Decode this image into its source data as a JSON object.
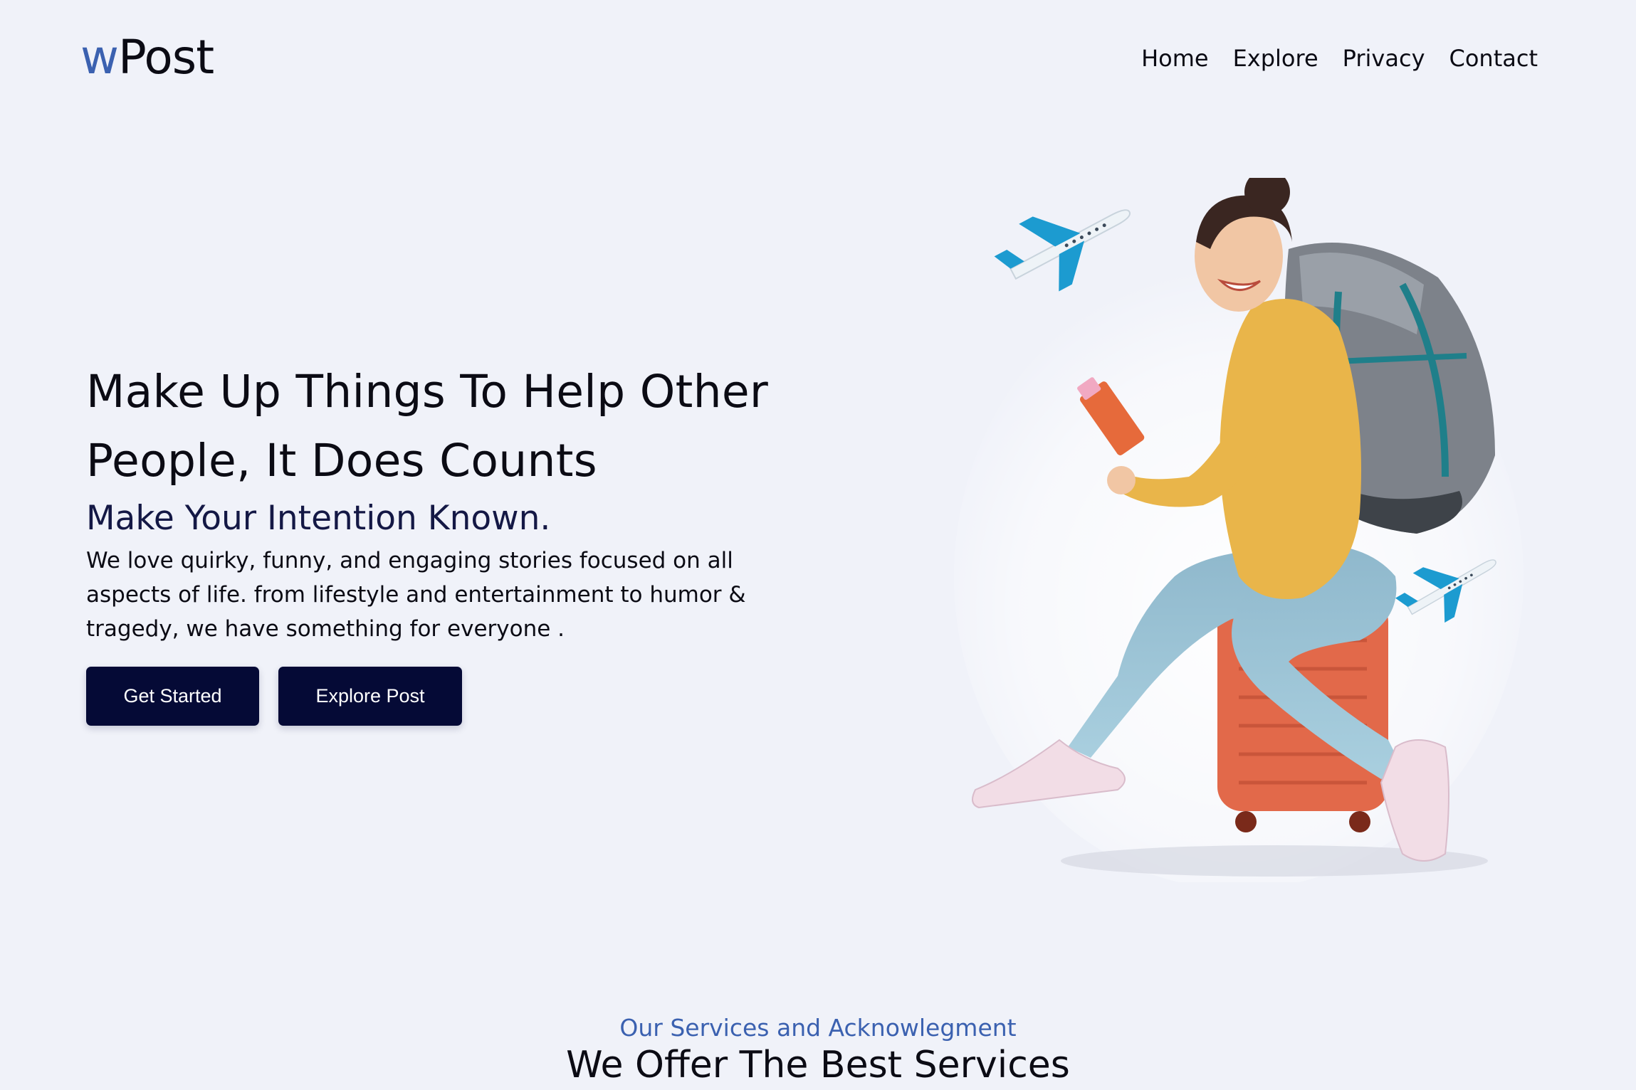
{
  "brand": {
    "logo_prefix": "w",
    "logo_rest": "Post",
    "accent_color": "#3b61b0",
    "dark_color": "#050a36",
    "background_color": "#f0f2f9"
  },
  "nav": {
    "items": [
      {
        "label": "Home"
      },
      {
        "label": "Explore"
      },
      {
        "label": "Privacy"
      },
      {
        "label": "Contact"
      }
    ]
  },
  "hero": {
    "title": "Make Up Things To Help Other People, It Does Counts",
    "subtitle": "Make Your Intention Known.",
    "description": "We love quirky, funny, and engaging stories focused on all aspects of life. from lifestyle and entertainment to humor & tragedy, we have something for everyone .",
    "buttons": {
      "primary": "Get Started",
      "secondary": "Explore Post"
    },
    "illustration": {
      "icons": [
        "traveler-illustration",
        "airplane-icon",
        "airplane-icon",
        "passport-icon",
        "backpack-icon",
        "suitcase-icon"
      ]
    }
  },
  "services": {
    "eyebrow": "Our Services and Acknowlegment",
    "title": "We Offer The Best Services"
  }
}
